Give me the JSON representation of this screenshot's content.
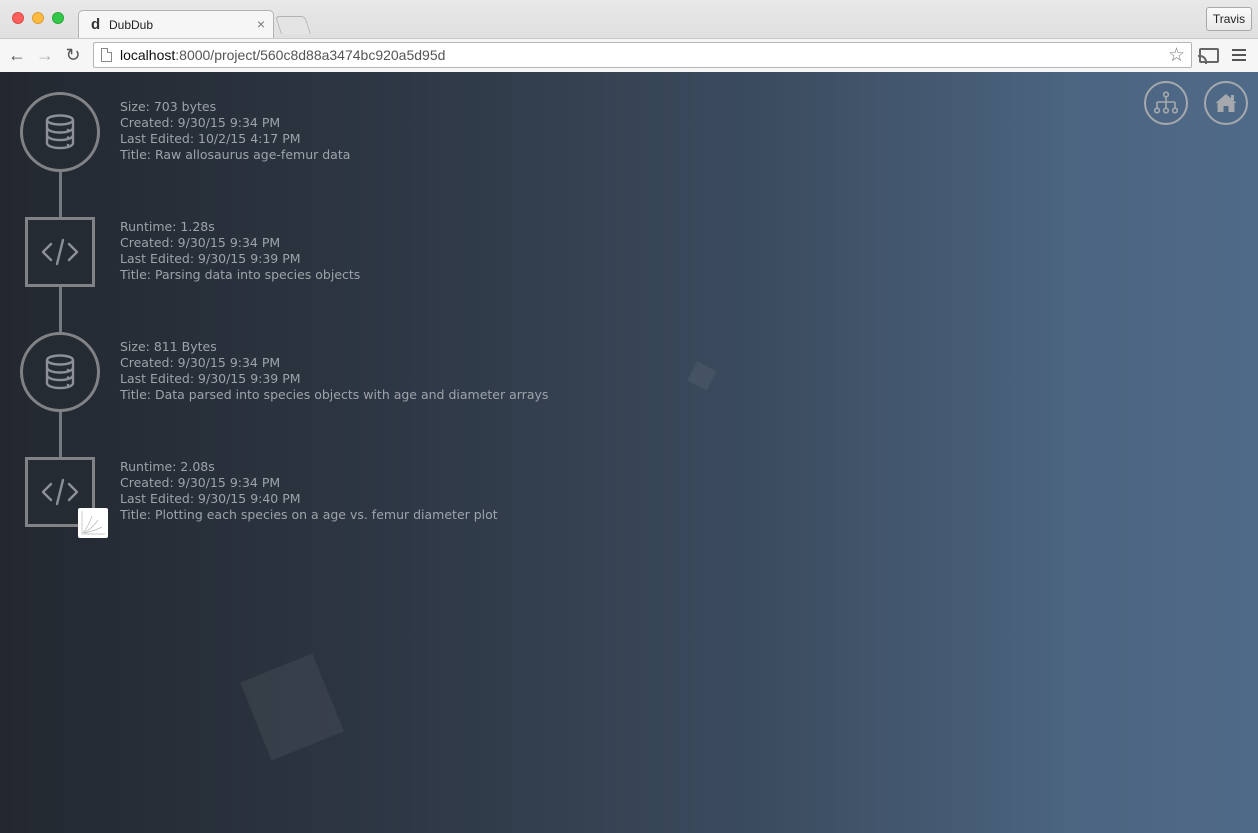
{
  "browser": {
    "tab_title": "DubDub",
    "tab_favicon": "d",
    "tab_close": "×",
    "profile_name": "Travis",
    "url_host": "localhost",
    "url_rest": ":8000/project/560c8d88a3474bc920a5d95d",
    "icons": {
      "back": "←",
      "forward": "→",
      "reload": "↻",
      "star": "☆"
    }
  },
  "pipeline": {
    "nodes": [
      {
        "type": "data",
        "icon": "database-icon",
        "line1": "Size: 703 bytes",
        "created": "Created: 9/30/15 9:34 PM",
        "edited": "Last Edited: 10/2/15 4:17 PM",
        "title": "Title: Raw allosaurus age-femur data"
      },
      {
        "type": "code",
        "icon": "code-icon",
        "line1": "Runtime: 1.28s",
        "created": "Created: 9/30/15 9:34 PM",
        "edited": "Last Edited: 9/30/15 9:39 PM",
        "title": "Title: Parsing data into species objects"
      },
      {
        "type": "data",
        "icon": "database-icon",
        "line1": "Size: 811 Bytes",
        "created": "Created: 9/30/15 9:34 PM",
        "edited": "Last Edited: 9/30/15 9:39 PM",
        "title": "Title: Data parsed into species objects with age and diameter arrays"
      },
      {
        "type": "code",
        "icon": "code-icon",
        "line1": "Runtime: 2.08s",
        "created": "Created: 9/30/15 9:34 PM",
        "edited": "Last Edited: 9/30/15 9:40 PM",
        "title": "Title: Plotting each species on a age vs. femur diameter plot"
      }
    ]
  },
  "top_buttons": {
    "tree_icon": "sitemap-icon",
    "home_icon": "home-icon"
  },
  "colors": {
    "background_left": "#232830",
    "background_right": "#4f6a88",
    "node_stroke": "#808286",
    "text": "#9ea3aa"
  }
}
